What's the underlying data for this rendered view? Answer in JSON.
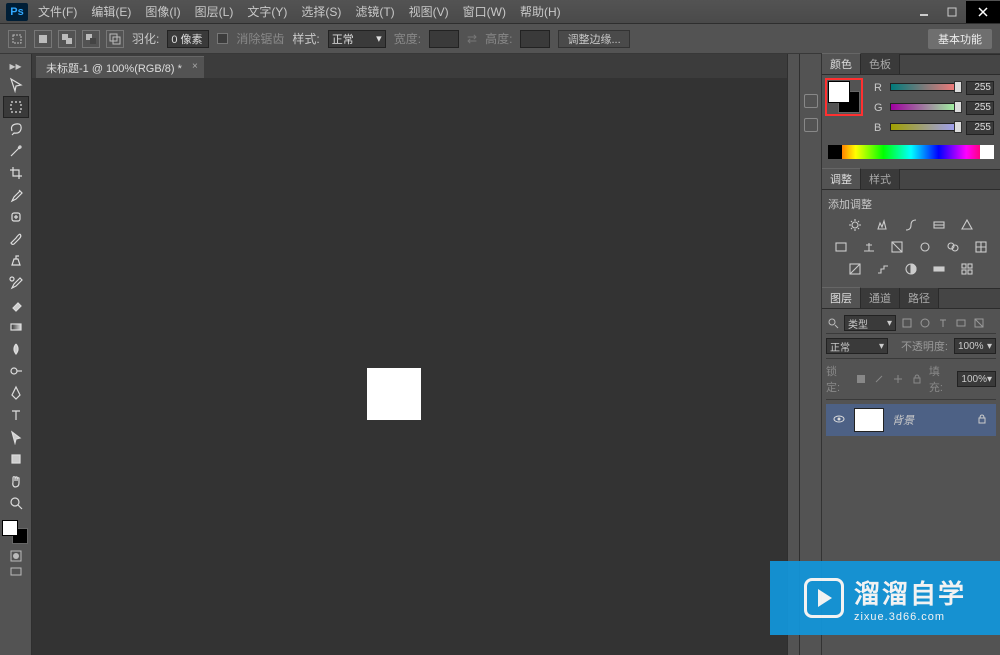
{
  "app": {
    "logo": "Ps"
  },
  "menu": [
    "文件(F)",
    "编辑(E)",
    "图像(I)",
    "图层(L)",
    "文字(Y)",
    "选择(S)",
    "滤镜(T)",
    "视图(V)",
    "窗口(W)",
    "帮助(H)"
  ],
  "options": {
    "feather_label": "羽化:",
    "feather_value": "0 像素",
    "antialias_label": "消除锯齿",
    "style_label": "样式:",
    "style_value": "正常",
    "width_label": "宽度:",
    "height_label": "高度:",
    "refine_edge": "调整边缘...",
    "basic": "基本功能"
  },
  "document": {
    "tab_title": "未标题-1 @ 100%(RGB/8) *"
  },
  "panels": {
    "color": {
      "tab1": "颜色",
      "tab2": "色板",
      "r": {
        "label": "R",
        "value": "255"
      },
      "g": {
        "label": "G",
        "value": "255"
      },
      "b": {
        "label": "B",
        "value": "255"
      }
    },
    "adjust": {
      "tab1": "调整",
      "tab2": "样式",
      "add_label": "添加调整"
    },
    "layers": {
      "tab1": "图层",
      "tab2": "通道",
      "tab3": "路径",
      "kind_label": "类型",
      "blend_mode": "正常",
      "opacity_label": "不透明度:",
      "opacity_value": "100%",
      "lock_label": "锁定:",
      "fill_label": "填充:",
      "fill_value": "100%",
      "layer_name": "背景"
    }
  },
  "watermark": {
    "big": "溜溜自学",
    "small": "zixue.3d66.com"
  }
}
